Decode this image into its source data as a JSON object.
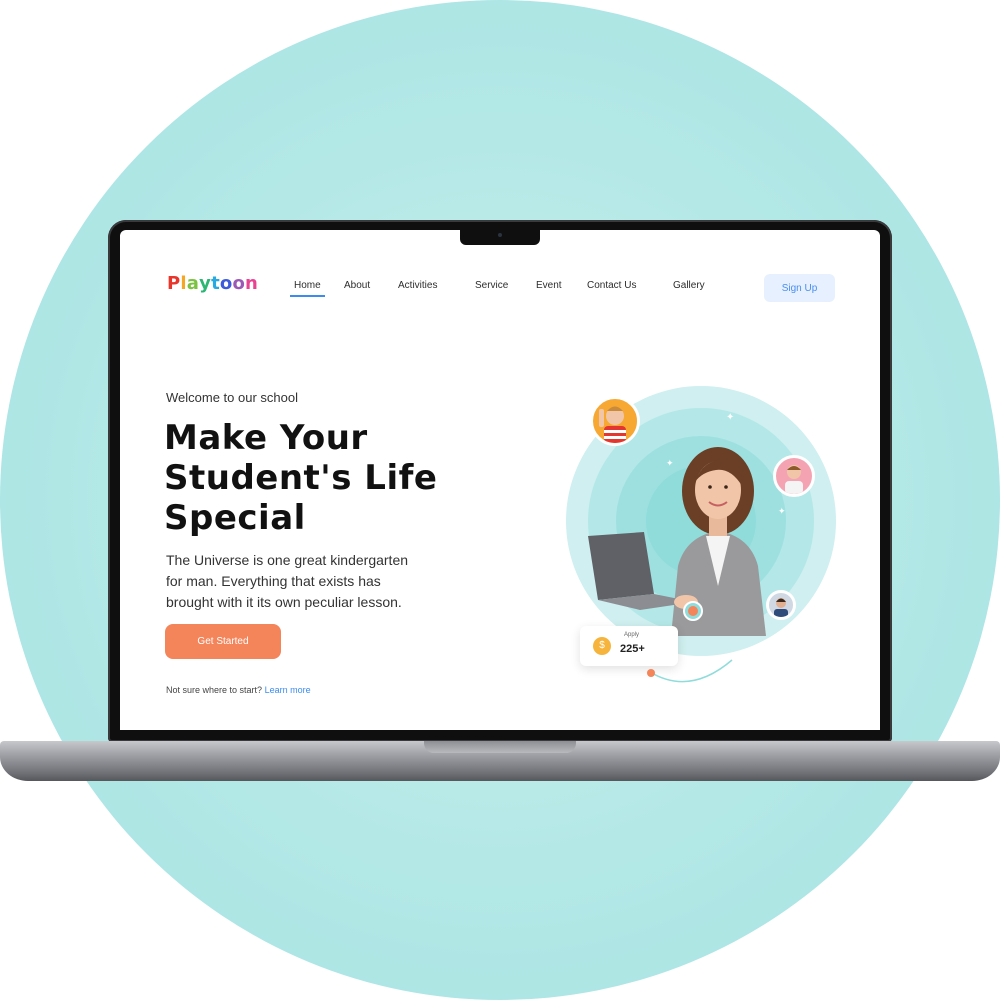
{
  "brand": {
    "name": "Playtoon",
    "letters": [
      {
        "ch": "P",
        "color": "#e8362d"
      },
      {
        "ch": "l",
        "color": "#f5a623"
      },
      {
        "ch": "a",
        "color": "#7cc242"
      },
      {
        "ch": "y",
        "color": "#2bb673"
      },
      {
        "ch": "t",
        "color": "#27a9e1"
      },
      {
        "ch": "o",
        "color": "#3b5bdb"
      },
      {
        "ch": "o",
        "color": "#9b59b6"
      },
      {
        "ch": "n",
        "color": "#e84393"
      }
    ]
  },
  "nav": {
    "links": [
      "Home",
      "About",
      "Activities",
      "Service",
      "Event",
      "Contact Us",
      "Gallery"
    ],
    "active_index": 0,
    "signup_label": "Sign Up"
  },
  "hero": {
    "eyebrow": "Welcome to our school",
    "headline_lines": [
      "Make Your",
      "Student's Life",
      "Special"
    ],
    "description_lines": [
      "The Universe is one great kindergarten",
      "for man. Everything that exists has",
      "brought with it its own peculiar lesson."
    ],
    "cta_label": "Get Started",
    "help_text": "Not sure where to start?",
    "help_link": "Learn more"
  },
  "stat": {
    "icon": "coin-icon",
    "label": "Apply",
    "value": "225+"
  },
  "colors": {
    "accent": "#f4845a",
    "link": "#3c8cf0",
    "ring_teal": "#8fdcdb",
    "signup_bg": "#e6f0fe"
  }
}
